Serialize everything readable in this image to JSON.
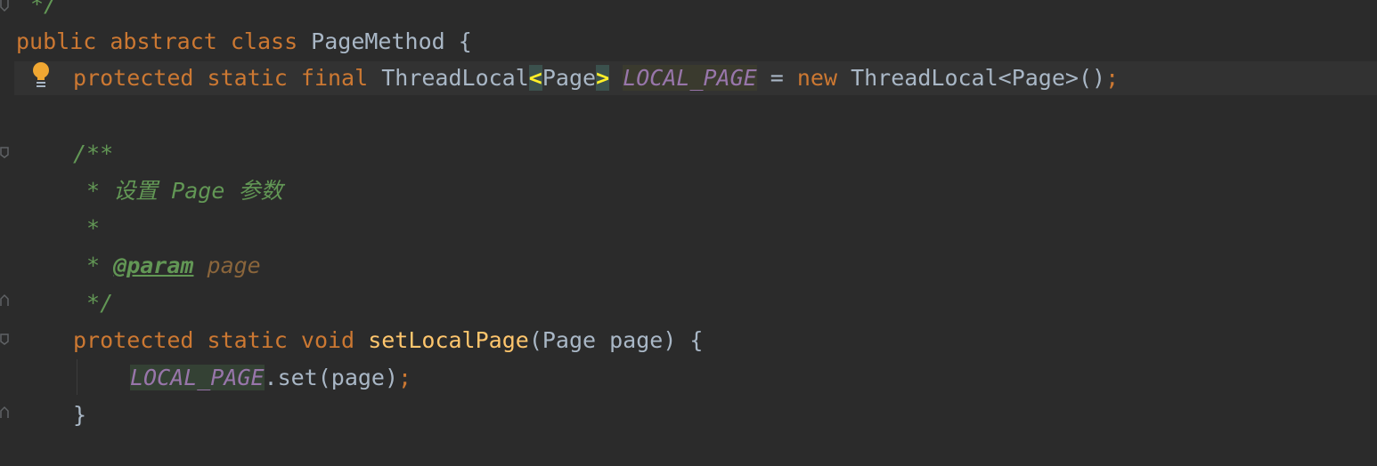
{
  "editor": {
    "lines": [
      {
        "tokens": [
          {
            "t": "*/",
            "c": "doc"
          }
        ]
      },
      {
        "tokens": [
          {
            "t": "public",
            "c": "kw"
          },
          {
            "t": " ",
            "c": "plain"
          },
          {
            "t": "abstract",
            "c": "kw"
          },
          {
            "t": " ",
            "c": "plain"
          },
          {
            "t": "class",
            "c": "kw"
          },
          {
            "t": " PageMethod {",
            "c": "plain"
          }
        ]
      },
      {
        "tokens": [
          {
            "t": "protected",
            "c": "kw"
          },
          {
            "t": " ",
            "c": "plain"
          },
          {
            "t": "static",
            "c": "kw"
          },
          {
            "t": " ",
            "c": "plain"
          },
          {
            "t": "final",
            "c": "kw"
          },
          {
            "t": " ThreadLocal",
            "c": "plain"
          },
          {
            "t": "<",
            "c": "brace-hl"
          },
          {
            "t": "Page",
            "c": "plain"
          },
          {
            "t": ">",
            "c": "brace-hl"
          },
          {
            "t": " ",
            "c": "plain"
          },
          {
            "t": "LOCAL_PAGE",
            "c": "field field-hl"
          },
          {
            "t": " = ",
            "c": "plain"
          },
          {
            "t": "new",
            "c": "kw"
          },
          {
            "t": " ThreadLocal<Page>()",
            "c": "plain"
          },
          {
            "t": ";",
            "c": "semi"
          }
        ]
      },
      {
        "tokens": []
      },
      {
        "tokens": [
          {
            "t": "/**",
            "c": "doc"
          }
        ]
      },
      {
        "tokens": [
          {
            "t": " * 设置 Page 参数",
            "c": "doc"
          }
        ]
      },
      {
        "tokens": [
          {
            "t": " *",
            "c": "doc"
          }
        ]
      },
      {
        "tokens": [
          {
            "t": " * ",
            "c": "doc"
          },
          {
            "t": "@param",
            "c": "doctag"
          },
          {
            "t": " ",
            "c": "doc"
          },
          {
            "t": "page",
            "c": "docparam"
          }
        ]
      },
      {
        "tokens": [
          {
            "t": " */",
            "c": "doc"
          }
        ]
      },
      {
        "tokens": [
          {
            "t": "protected",
            "c": "kw"
          },
          {
            "t": " ",
            "c": "plain"
          },
          {
            "t": "static",
            "c": "kw"
          },
          {
            "t": " ",
            "c": "plain"
          },
          {
            "t": "void",
            "c": "kw"
          },
          {
            "t": " ",
            "c": "plain"
          },
          {
            "t": "setLocalPage",
            "c": "method"
          },
          {
            "t": "(Page page) {",
            "c": "plain"
          }
        ]
      },
      {
        "tokens": [
          {
            "t": "LOCAL_PAGE",
            "c": "field field-hl2"
          },
          {
            "t": ".set(page)",
            "c": "plain"
          },
          {
            "t": ";",
            "c": "semi"
          }
        ]
      },
      {
        "tokens": [
          {
            "t": "}",
            "c": "plain"
          }
        ]
      }
    ],
    "colors": {
      "background": "#2b2b2b",
      "keyword": "#cc7832",
      "identifier": "#a9b7c6",
      "field": "#9876aa",
      "method": "#ffc66d",
      "doc_comment": "#629755",
      "current_line": "#323232",
      "intention_bulb": "#f0a732"
    },
    "icons": {
      "intention": "lightbulb-icon",
      "fold": "fold-marker-icon"
    }
  }
}
